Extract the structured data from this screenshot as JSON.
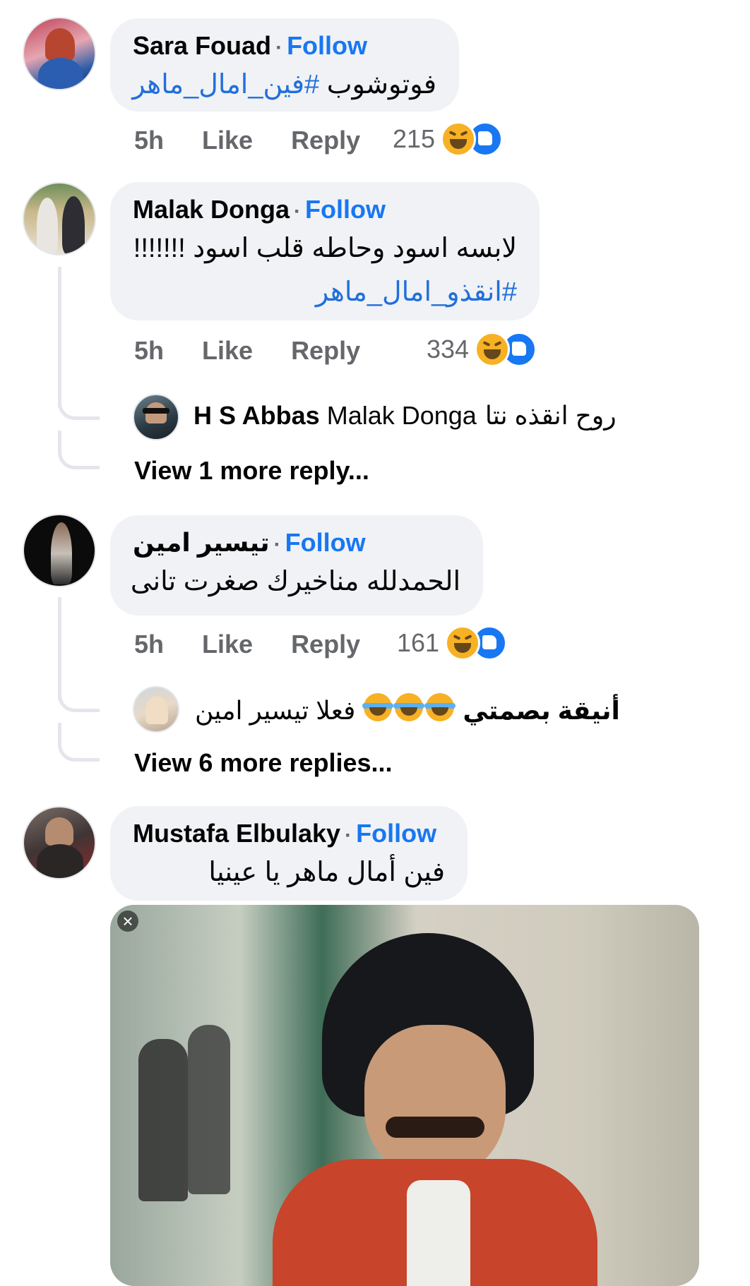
{
  "comments": [
    {
      "author": "Sara Fouad",
      "follow_label": "Follow",
      "text_plain": "فوتوشوب ",
      "text_tag": "#فين_امال_ماهر",
      "time": "5h",
      "like_label": "Like",
      "reply_label": "Reply",
      "reaction_count": "215"
    },
    {
      "author": "Malak Donga",
      "follow_label": "Follow",
      "text_line1": "لابسه اسود وحاطه قلب اسود !!!!!!!",
      "text_tag": "#انقذو_امال_ماهر",
      "time": "5h",
      "like_label": "Like",
      "reply_label": "Reply",
      "reaction_count": "334",
      "reply": {
        "author": "H S Abbas",
        "mention": "Malak Donga",
        "text": "روح انقذه نتا"
      },
      "view_more": "View 1 more reply..."
    },
    {
      "author": "تيسير امين",
      "follow_label": "Follow",
      "text": "الحمدلله مناخيرك صغرت تانى",
      "time": "5h",
      "like_label": "Like",
      "reply_label": "Reply",
      "reaction_count": "161",
      "reply": {
        "author": "أنيقة بصمتي",
        "mention": "تيسير امين",
        "text": "فعلا"
      },
      "view_more": "View 6 more replies..."
    },
    {
      "author": "Mustafa Elbulaky",
      "follow_label": "Follow",
      "text": "فين أمال ماهر يا عينيا"
    }
  ],
  "icons": {
    "reaction_haha": "haha-icon",
    "reaction_like": "like-icon",
    "close": "close-icon"
  },
  "colors": {
    "link_blue": "#1877f2",
    "bubble_bg": "#f0f2f5",
    "meta_gray": "#65676b"
  }
}
